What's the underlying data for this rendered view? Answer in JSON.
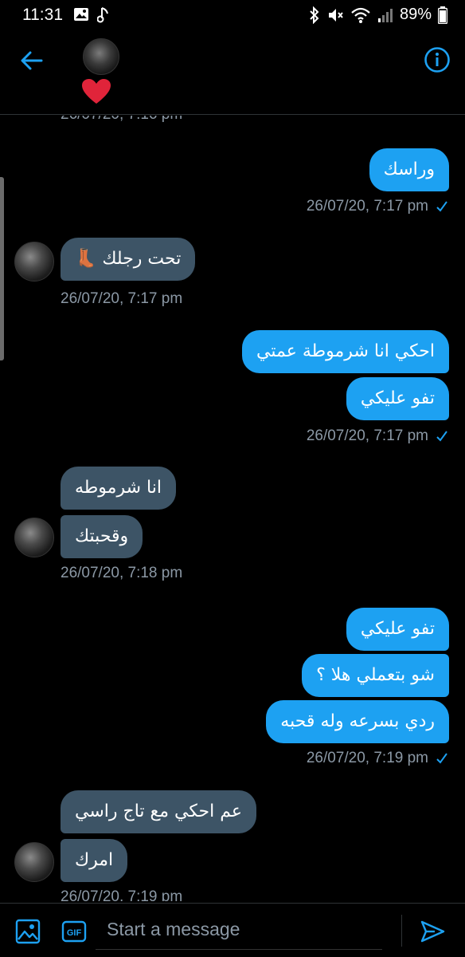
{
  "status_bar": {
    "time": "11:31",
    "battery": "89%",
    "left_icons": [
      "image-icon",
      "music-note-icon"
    ],
    "right_icons": [
      "bluetooth-icon",
      "mute-icon",
      "wifi-icon",
      "signal-icon",
      "battery-icon"
    ]
  },
  "header": {
    "back_icon": "arrow-left-icon",
    "info_icon": "info-icon",
    "heart": "❤",
    "accent": "#1da1f2"
  },
  "messages": {
    "prev_timestamp": "26/07/20, 7:16 pm",
    "m1": "وراسك",
    "t1": "26/07/20, 7:17 pm",
    "m2": "تحت رجلك 👢",
    "t2": "26/07/20, 7:17 pm",
    "m3": "احكي انا شرموطة عمتي",
    "m4": "تفو عليكي",
    "t3": "26/07/20, 7:17 pm",
    "m5": "انا شرموطه",
    "m6": "وقحبتك",
    "t4": "26/07/20, 7:18 pm",
    "m7": "تفو عليكي",
    "m8": "شو بتعملي هلا ؟",
    "m9": "ردي بسرعه وله قحبه",
    "t5": "26/07/20, 7:19 pm",
    "m10": "عم احكي مع تاج راسي",
    "m11": "امرك",
    "t6": "26/07/20, 7:19 pm",
    "sent_color": "#1da1f2",
    "received_color": "#3d5466"
  },
  "composer": {
    "placeholder": "Start a message",
    "gif_label": "GIF",
    "image_icon": "image-icon",
    "send_icon": "send-icon"
  }
}
